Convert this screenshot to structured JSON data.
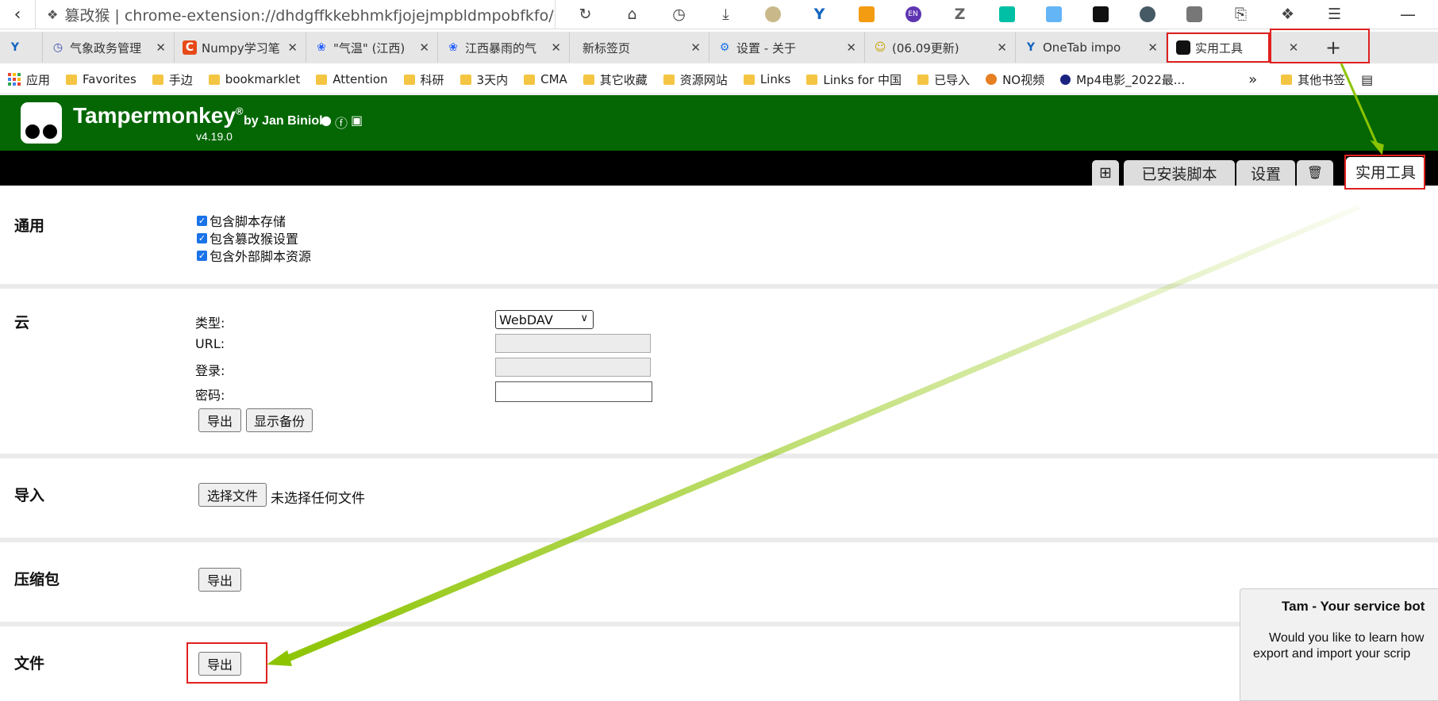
{
  "browser": {
    "address_text": "篡改猴 | chrome-extension://dhdgffkkebhmkfjojejmpbldmpobfkfo/...",
    "tabs": [
      {
        "label": "",
        "icon": "onetab-icon",
        "color": "#1565c0"
      },
      {
        "label": "气象政务管理",
        "icon": "clock-icon",
        "color": "#3949ab"
      },
      {
        "label": "Numpy学习笔",
        "icon": "c-logo-icon",
        "color": "#e64a19"
      },
      {
        "label": "\"气温\" (江西)",
        "icon": "baidu-paw-icon",
        "color": "#2962ff"
      },
      {
        "label": "江西暴雨的气",
        "icon": "baidu-paw-icon",
        "color": "#2962ff"
      },
      {
        "label": "新标签页",
        "icon": "",
        "color": ""
      },
      {
        "label": "设置 - 关于",
        "icon": "gear-icon",
        "color": "#1a73e8"
      },
      {
        "label": "(06.09更新)",
        "icon": "smiley-icon",
        "color": "#f4c542"
      },
      {
        "label": "OneTab impo",
        "icon": "onetab-icon",
        "color": "#1565c0"
      },
      {
        "label": "实用工具",
        "icon": "tampermonkey-icon",
        "color": "#000000"
      }
    ],
    "bookmarks": [
      "应用",
      "Favorites",
      "手边",
      "bookmarklet",
      "Attention",
      "科研",
      "3天内",
      "CMA",
      "其它收藏",
      "资源网站",
      "Links",
      "Links for 中国",
      "已导入",
      "NO视频",
      "Mp4电影_2022最...",
      "其他书签"
    ]
  },
  "tm": {
    "title": "Tampermonkey",
    "reg": "®",
    "by": "by Jan Biniok",
    "version": "v4.19.0",
    "tabs": {
      "installed": "已安装脚本",
      "settings": "设置",
      "utilities": "实用工具"
    }
  },
  "general": {
    "title": "通用",
    "opt1": "包含脚本存储",
    "opt2": "包含篡改猴设置",
    "opt3": "包含外部脚本资源"
  },
  "cloud": {
    "title": "云",
    "type_label": "类型:",
    "type_value": "WebDAV",
    "url_label": "URL:",
    "login_label": "登录:",
    "password_label": "密码:",
    "export_label": "导出",
    "show_backups_label": "显示备份"
  },
  "import": {
    "title": "导入",
    "choose_label": "选择文件",
    "no_file_text": "未选择任何文件"
  },
  "zip": {
    "title": "压缩包",
    "export_label": "导出"
  },
  "file": {
    "title": "文件",
    "export_label": "导出"
  },
  "bot": {
    "title": "Tam - Your service bot",
    "line1": "Would you like to learn how",
    "line2": "export and import your scrip"
  },
  "colors": {
    "header_green": "#046704",
    "highlight_red": "#e02020",
    "arrow_green": "#8cc400"
  }
}
